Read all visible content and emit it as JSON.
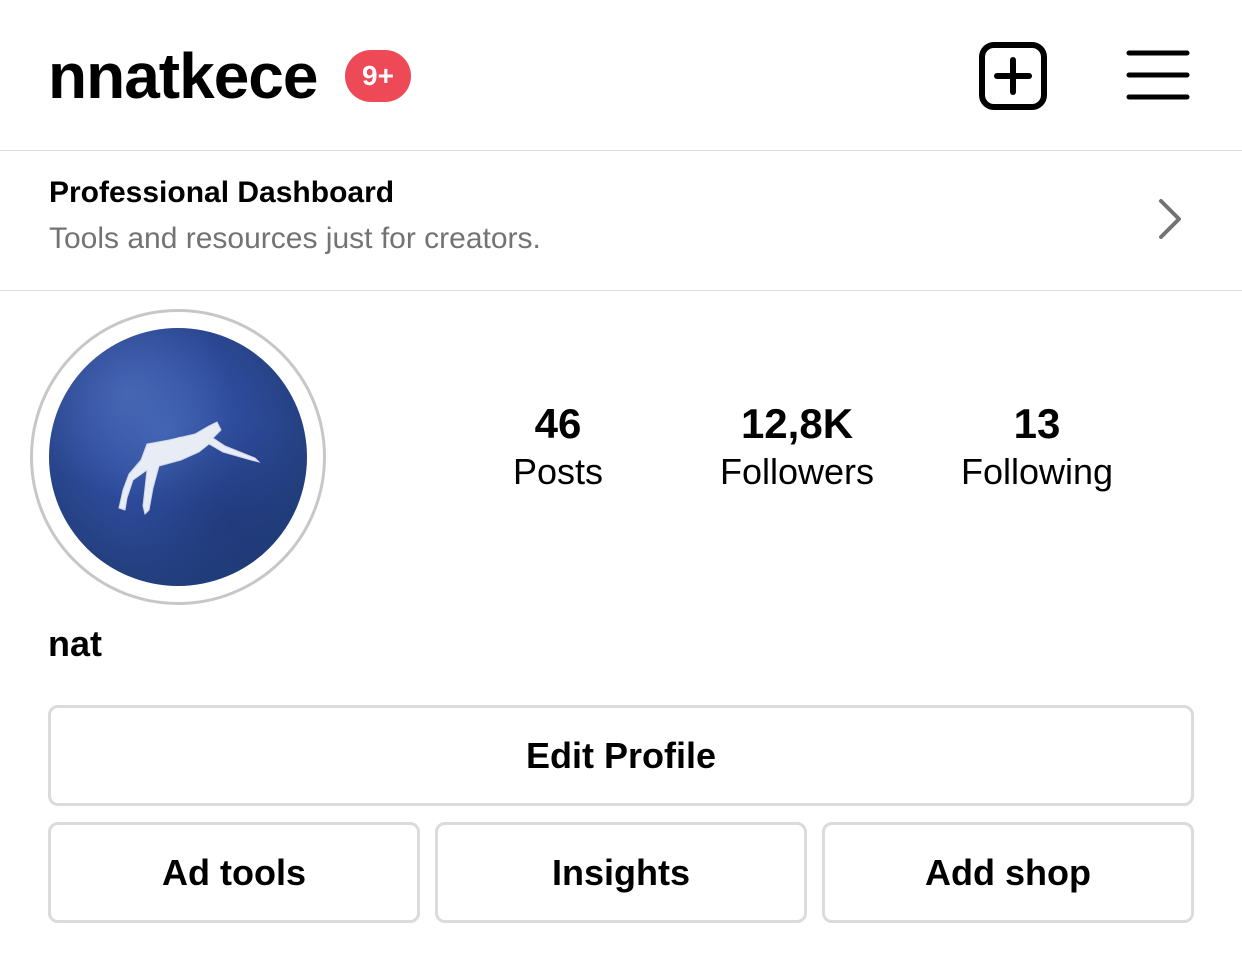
{
  "header": {
    "username": "nnatkece",
    "notification_badge": "9+",
    "badge_color": "#ed4956",
    "new_post_icon": "plus-square-icon",
    "menu_icon": "hamburger-menu-icon"
  },
  "dashboard": {
    "title": "Professional Dashboard",
    "subtitle": "Tools and resources just for creators.",
    "chevron_icon": "chevron-right-icon"
  },
  "profile": {
    "display_name": "nat",
    "avatar_icon": "profile-picture-watercolor"
  },
  "stats": [
    {
      "value": "46",
      "label": "Posts"
    },
    {
      "value": "12,8K",
      "label": "Followers"
    },
    {
      "value": "13",
      "label": "Following"
    }
  ],
  "buttons": {
    "edit_profile": "Edit Profile",
    "ad_tools": "Ad tools",
    "insights": "Insights",
    "add_shop": "Add shop"
  }
}
